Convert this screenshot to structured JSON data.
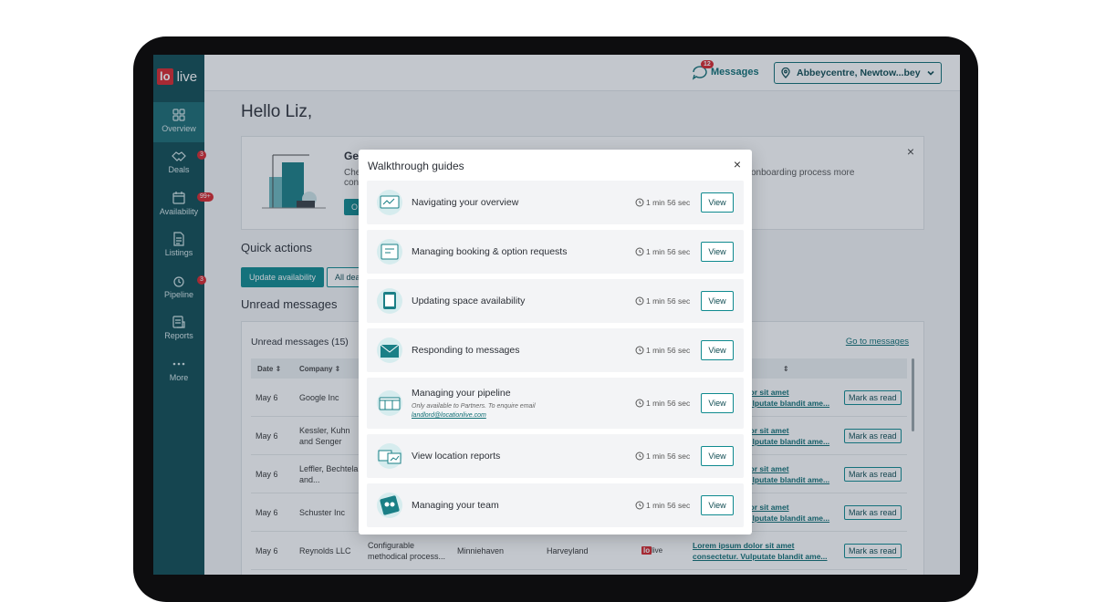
{
  "app": {
    "logo_box": "lo",
    "logo_text": "live"
  },
  "sidebar": {
    "items": [
      {
        "label": "Overview",
        "icon": "grid-icon",
        "badge": ""
      },
      {
        "label": "Deals",
        "icon": "handshake-icon",
        "badge": "3"
      },
      {
        "label": "Availability",
        "icon": "calendar-icon",
        "badge": "99+"
      },
      {
        "label": "Listings",
        "icon": "document-icon",
        "badge": ""
      },
      {
        "label": "Pipeline",
        "icon": "pipeline-icon",
        "badge": "3"
      },
      {
        "label": "Reports",
        "icon": "report-icon",
        "badge": ""
      },
      {
        "label": "More",
        "icon": "more-icon",
        "badge": ""
      }
    ]
  },
  "topbar": {
    "messages_label": "Messages",
    "messages_badge": "12",
    "location": "Abbeycentre, Newtow...bey"
  },
  "main": {
    "greeting": "Hello Liz,",
    "banner": {
      "title": "Ge",
      "text_line1": "Che",
      "text_line2": "con",
      "text_right": "onboarding process more",
      "button": "O"
    },
    "quick_actions_title": "Quick actions",
    "quick_actions": [
      "Update availability",
      "All dea"
    ],
    "unread_section_title": "Unread messages",
    "unread_card_title": "Unread messages (15)",
    "goto_messages": "Go to messages",
    "table_headers": {
      "date": "Date",
      "company": "Company"
    },
    "rows": [
      {
        "date": "May 6",
        "company": "Google Inc",
        "c3": "",
        "c4": "",
        "c5": "",
        "msg1": "olor sit amet",
        "msg2": "Vulputate blandit ame...",
        "action": "Mark as read"
      },
      {
        "date": "May 6",
        "company": "Kessler, Kuhn and Senger",
        "c3": "",
        "c4": "",
        "c5": "",
        "msg1": "olor sit amet",
        "msg2": "Vulputate blandit ame...",
        "action": "Mark as read"
      },
      {
        "date": "May 6",
        "company": "Leffler, Bechtelar and...",
        "c3": "",
        "c4": "",
        "c5": "",
        "msg1": "olor sit amet",
        "msg2": "Vulputate blandit ame...",
        "action": "Mark as read"
      },
      {
        "date": "May 6",
        "company": "Schuster Inc",
        "c3": "",
        "c4": "",
        "c5": "",
        "msg1": "olor sit amet",
        "msg2": "Vulputate blandit ame...",
        "action": "Mark as read"
      },
      {
        "date": "May 6",
        "company": "Reynolds LLC",
        "c3": "Configurable methodical process...",
        "c4": "Minniehaven",
        "c5": "Harveyland",
        "msg1": "Lorem ipsum dolor sit amet",
        "msg2": "consectetur. Vulputate blandit ame...",
        "action": "Mark as read"
      }
    ]
  },
  "modal": {
    "title": "Walkthrough guides",
    "close": "×",
    "guides": [
      {
        "title": "Navigating your overview",
        "duration": "1 min 56 sec",
        "button": "View",
        "icon": "overview-illustration-icon"
      },
      {
        "title": "Managing booking & option requests",
        "duration": "1 min 56 sec",
        "button": "View",
        "icon": "booking-illustration-icon"
      },
      {
        "title": "Updating space availability",
        "duration": "1 min 56 sec",
        "button": "View",
        "icon": "availability-illustration-icon"
      },
      {
        "title": "Responding to messages",
        "duration": "1 min 56 sec",
        "button": "View",
        "icon": "envelope-illustration-icon"
      },
      {
        "title": "Managing your pipeline",
        "subtitle": "Only available to Partners. To enquire email",
        "email": "landlord@locationlive.com",
        "duration": "1 min 56 sec",
        "button": "View",
        "icon": "pipeline-illustration-icon"
      },
      {
        "title": "View location reports",
        "duration": "1 min 56 sec",
        "button": "View",
        "icon": "reports-illustration-icon"
      },
      {
        "title": "Managing your team",
        "duration": "1 min 56 sec",
        "button": "View",
        "icon": "team-illustration-icon"
      }
    ]
  },
  "colors": {
    "sidebar": "#0f4c52",
    "accent": "#0f8a8f",
    "badge": "#d9262c"
  }
}
